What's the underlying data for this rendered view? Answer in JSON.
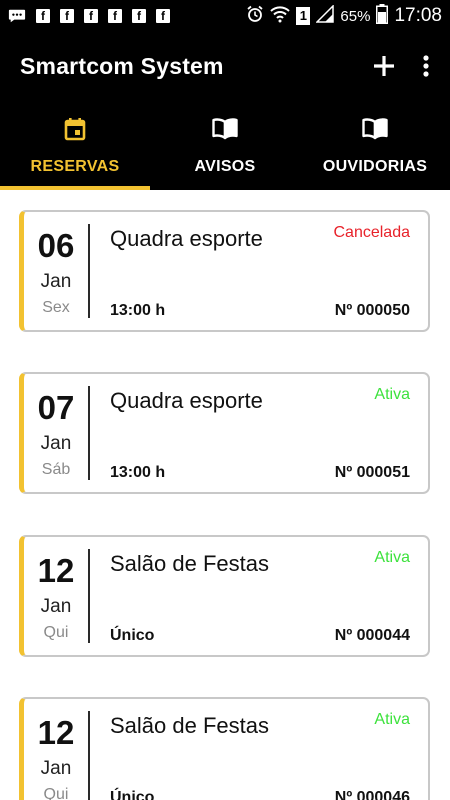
{
  "status_bar": {
    "battery": "65%",
    "time": "17:08",
    "sim": "1"
  },
  "toolbar": {
    "title": "Smartcom System",
    "add_icon": "plus-icon",
    "menu_icon": "more-vert-icon"
  },
  "tabs": [
    {
      "label": "RESERVAS",
      "icon": "calendar-icon",
      "active": true
    },
    {
      "label": "AVISOS",
      "icon": "book-icon",
      "active": false
    },
    {
      "label": "OUVIDORIAS",
      "icon": "book-icon",
      "active": false
    }
  ],
  "colors": {
    "accent": "#f2c231",
    "status_cancelled": "#e8222a",
    "status_active": "#3de23d",
    "header_bg": "#000000"
  },
  "reservations": [
    {
      "day": "06",
      "month": "Jan",
      "weekday": "Sex",
      "place": "Quadra esporte",
      "status": "Cancelada",
      "status_type": "cancelled",
      "detail": "13:00 h",
      "number": "Nº 000050"
    },
    {
      "day": "07",
      "month": "Jan",
      "weekday": "Sáb",
      "place": "Quadra esporte",
      "status": "Ativa",
      "status_type": "active",
      "detail": "13:00 h",
      "number": "Nº 000051"
    },
    {
      "day": "12",
      "month": "Jan",
      "weekday": "Qui",
      "place": "Salão de Festas",
      "status": "Ativa",
      "status_type": "active",
      "detail": "Único",
      "number": "Nº 000044"
    },
    {
      "day": "12",
      "month": "Jan",
      "weekday": "Qui",
      "place": "Salão de Festas",
      "status": "Ativa",
      "status_type": "active",
      "detail": "Único",
      "number": "Nº 000046"
    }
  ]
}
